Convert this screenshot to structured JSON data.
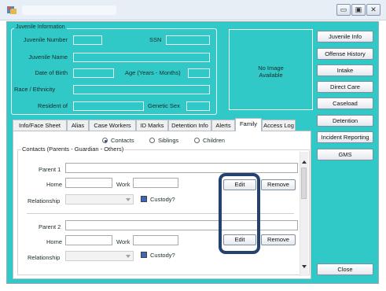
{
  "window": {
    "minimize_glyph": "▭",
    "maximize_glyph": "▣",
    "close_glyph": "✕"
  },
  "info": {
    "legend": "Juvenile Information",
    "juvenile_number_label": "Juvenile Number",
    "ssn_label": "SSN",
    "juvenile_name_label": "Juvenile Name",
    "dob_label": "Date of Birth",
    "age_label": "Age (Years - Months)",
    "race_label": "Race / Ethnicity",
    "resident_label": "Resident of",
    "genetic_sex_label": "Genetic Sex",
    "photo_text": "No Image\nAvailable"
  },
  "sidebar": {
    "buttons": [
      "Juvenile Info",
      "Offense History",
      "Intake",
      "Direct Care",
      "Caseload",
      "Detention",
      "Incident Reporting",
      "GMS"
    ],
    "close": "Close"
  },
  "tabs": [
    "Info/Face Sheet",
    "Alias",
    "Case Workers",
    "ID Marks",
    "Detention Info",
    "Alerts",
    "Family",
    "Access Log"
  ],
  "active_tab": "Family",
  "family": {
    "radios": [
      "Contacts",
      "Siblings",
      "Children"
    ],
    "selected_radio": "Contacts",
    "group_legend": "Contacts (Parents - Guardian - Others)",
    "parents": [
      {
        "label": "Parent 1",
        "home_label": "Home",
        "work_label": "Work",
        "relationship_label": "Relationship",
        "custody_label": "Custody?",
        "edit": "Edit",
        "remove": "Remove"
      },
      {
        "label": "Parent 2",
        "home_label": "Home",
        "work_label": "Work",
        "relationship_label": "Relationship",
        "custody_label": "Custody?",
        "edit": "Edit",
        "remove": "Remove"
      }
    ]
  },
  "colors": {
    "background": "#31c9c7",
    "highlight": "#23426e"
  },
  "icons": {
    "app": "app-icon",
    "dropdown": "chevron-down-icon",
    "scroll_up": "triangle-up-icon",
    "scroll_down": "triangle-down-icon"
  }
}
